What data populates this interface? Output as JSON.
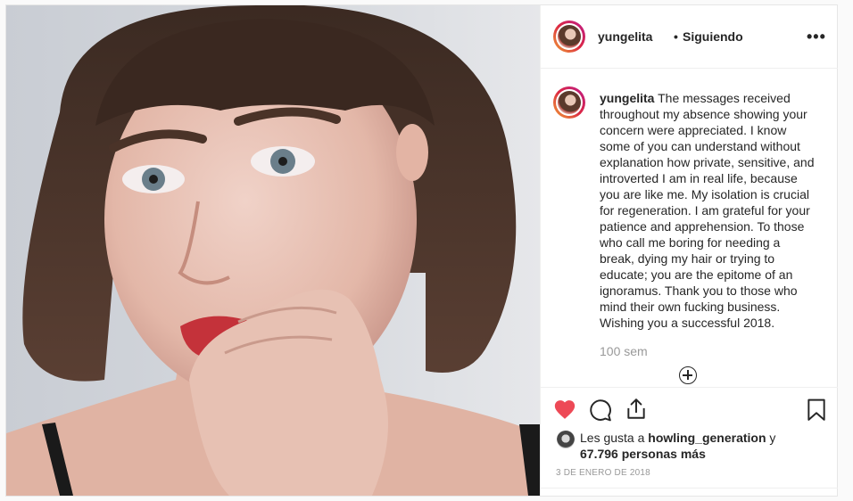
{
  "header": {
    "username": "yungelita",
    "separator": "•",
    "follow_status": "Siguiendo",
    "more_label": "•••"
  },
  "caption": {
    "username": "yungelita",
    "text": "The messages received throughout my absence showing your concern were appreciated. I know some of you can understand without explanation how private, sensitive, and introverted I am in real life, because you are like me. My isolation is crucial for regeneration. I am grateful for your patience and apprehension. To those who call me boring for needing a break, dying my hair or trying to educate; you are the epitome of an ignoramus. Thank you to those who mind their own fucking business. Wishing you a successful 2018.",
    "time_ago": "100 sem"
  },
  "likes": {
    "prefix": "Les gusta a",
    "user": "howling_generation",
    "connector": "y",
    "count": "67.796 personas más"
  },
  "date": "3 DE ENERO DE 2018",
  "icons": {
    "like": "heart-icon",
    "comment": "comment-icon",
    "share": "share-icon",
    "save": "bookmark-icon",
    "add_comment": "plus-circle-icon"
  },
  "colors": {
    "like_red": "#ed4956",
    "muted": "#999999",
    "text": "#262626"
  }
}
